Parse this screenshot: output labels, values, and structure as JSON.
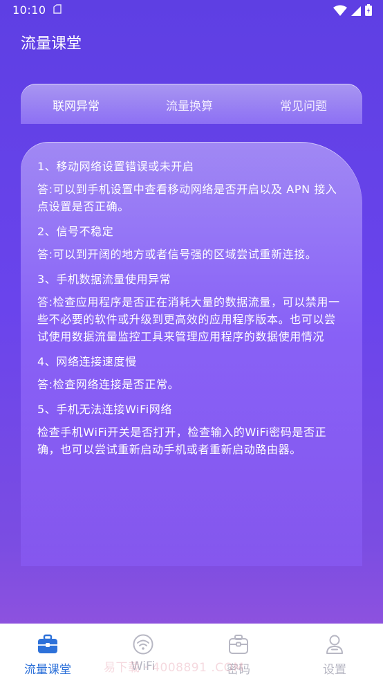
{
  "status_bar": {
    "time": "10:10"
  },
  "header": {
    "title": "流量课堂"
  },
  "tabs": [
    {
      "label": "联网异常"
    },
    {
      "label": "流量换算"
    },
    {
      "label": "常见问题"
    }
  ],
  "content": {
    "items": [
      {
        "q": "1、移动网络设置错误或未开启",
        "a": "答:可以到手机设置中查看移动网络是否开启以及 APN 接入点设置是否正确。"
      },
      {
        "q": "2、信号不稳定",
        "a": "答:可以到开阔的地方或者信号强的区域尝试重新连接。"
      },
      {
        "q": "3、手机数据流量使用异常",
        "a": "答:检查应用程序是否正在消耗大量的数据流量，可以禁用一些不必要的软件或升级到更高效的应用程序版本。也可以尝试使用数据流量监控工具来管理应用程序的数据使用情况"
      },
      {
        "q": "4、网络连接速度慢",
        "a": "答:检查网络连接是否正常。"
      },
      {
        "q": "5、手机无法连接WiFi网络",
        "a": "检查手机WiFi开关是否打开，检查输入的WiFi密码是否正确，也可以尝试重新启动手机或者重新启动路由器。"
      }
    ]
  },
  "bottom_nav": {
    "items": [
      {
        "label": "流量课堂",
        "icon": "toolbox-icon"
      },
      {
        "label": "WiFi",
        "icon": "wifi-icon"
      },
      {
        "label": "密码",
        "icon": "briefcase-icon"
      },
      {
        "label": "设置",
        "icon": "user-icon"
      }
    ],
    "active_color": "#2d71d9",
    "inactive_color": "#b7b7c3"
  },
  "watermark": "易下载 · 4008891 .COM"
}
